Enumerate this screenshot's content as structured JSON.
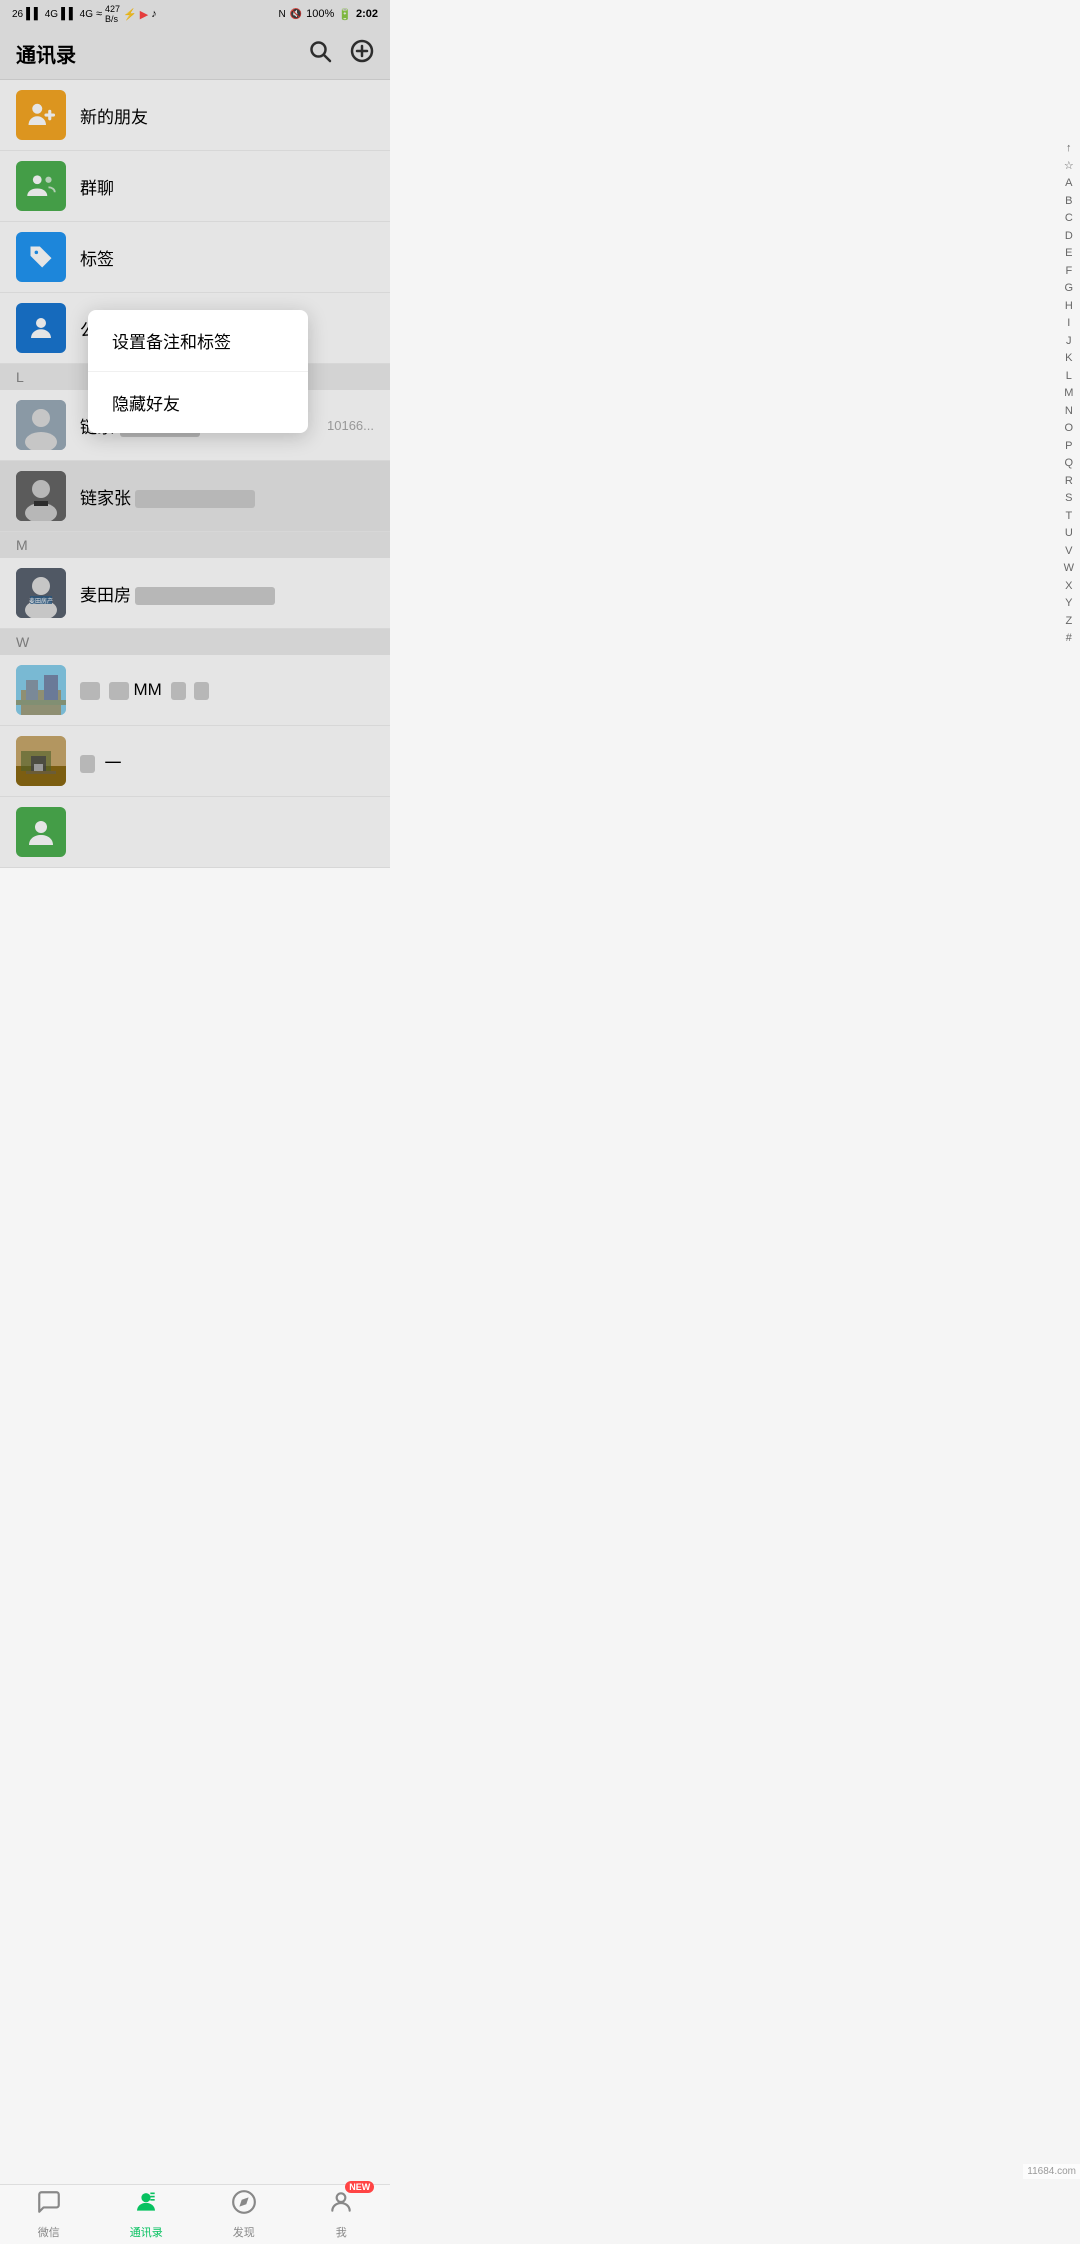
{
  "statusBar": {
    "left": "26  4G  4G  ≈  427 B/s  ψ",
    "right": "N  🔇  100%  2:02",
    "signal1": "26",
    "signal2": "4G",
    "signal3": "4G",
    "wifi": "≈",
    "speed": "427 B/s",
    "battery": "100%",
    "time": "2:02"
  },
  "header": {
    "title": "通讯录",
    "searchLabel": "search",
    "addLabel": "add"
  },
  "alphabetIndex": [
    "↑",
    "☆",
    "A",
    "B",
    "C",
    "D",
    "E",
    "F",
    "G",
    "H",
    "I",
    "J",
    "K",
    "L",
    "M",
    "N",
    "O",
    "P",
    "Q",
    "R",
    "S",
    "T",
    "U",
    "V",
    "W",
    "X",
    "Y",
    "Z",
    "#"
  ],
  "contextMenu": {
    "items": [
      "设置备注和标签",
      "隐藏好友"
    ]
  },
  "sections": [
    {
      "type": "item",
      "icon": "new-friend",
      "iconBg": "orange",
      "name": "新的朋友"
    },
    {
      "type": "item",
      "icon": "group",
      "iconBg": "green",
      "name": "群聊"
    },
    {
      "type": "item",
      "icon": "tag",
      "iconBg": "blue",
      "name": "标签"
    },
    {
      "type": "item",
      "icon": "official",
      "iconBg": "blue2",
      "name": "公众号"
    },
    {
      "type": "section-header",
      "label": "L"
    },
    {
      "type": "contact",
      "name": "链家-",
      "blurred": true,
      "highlighted": false,
      "hasPhoto": true,
      "photoType": "person-male"
    },
    {
      "type": "contact",
      "name": "链家张",
      "blurred": true,
      "highlighted": true,
      "hasPhoto": true,
      "photoType": "person-male2"
    },
    {
      "type": "section-header",
      "label": "M"
    },
    {
      "type": "contact",
      "name": "麦田房产",
      "blurred": true,
      "highlighted": false,
      "hasPhoto": true,
      "photoType": "person-male3"
    },
    {
      "type": "section-header",
      "label": "W"
    },
    {
      "type": "contact",
      "name": "██ ██MM 丁 ██",
      "blurred": true,
      "highlighted": false,
      "hasPhoto": true,
      "photoType": "building"
    },
    {
      "type": "contact",
      "name": "█ 一",
      "blurred": true,
      "highlighted": false,
      "hasPhoto": true,
      "photoType": "landscape"
    },
    {
      "type": "contact",
      "name": "",
      "blurred": false,
      "highlighted": false,
      "hasPhoto": true,
      "photoType": "green-icon"
    }
  ],
  "bottomNav": {
    "items": [
      {
        "id": "weixin",
        "label": "微信",
        "icon": "chat",
        "active": false
      },
      {
        "id": "contacts",
        "label": "通讯录",
        "icon": "contacts",
        "active": true
      },
      {
        "id": "discover",
        "label": "发现",
        "icon": "discover",
        "active": false
      },
      {
        "id": "me",
        "label": "我",
        "icon": "me",
        "active": false,
        "badge": "NEW"
      }
    ]
  },
  "watermark": "11684.com"
}
